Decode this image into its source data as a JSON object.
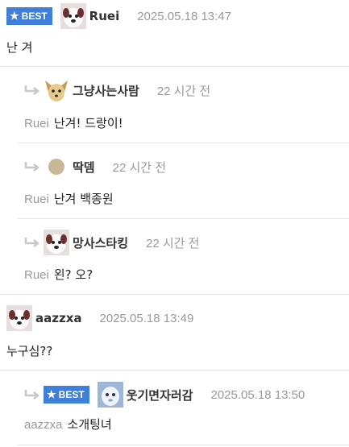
{
  "comments": [
    {
      "author": "Ruei",
      "time": "2025.05.18 13:47",
      "badge": "BEST",
      "text": "난 겨",
      "avatar": "white-dog-avatar"
    },
    {
      "author": "그냥사는사람",
      "time": "22 시간 전",
      "mention": "Ruei",
      "text": "난겨! 드랑이!",
      "avatar": "chihuahua-avatar"
    },
    {
      "author": "딱뎀",
      "time": "22 시간 전",
      "mention": "Ruei",
      "text": "난겨 백종원",
      "avatar": "beige-circle-avatar"
    },
    {
      "author": "망사스타킹",
      "time": "22 시간 전",
      "mention": "Ruei",
      "text": "왼? 오?",
      "avatar": "white-dog-avatar"
    },
    {
      "author": "aazzxa",
      "time": "2025.05.18 13:49",
      "text": "누구심??",
      "avatar": "white-dog-avatar"
    },
    {
      "author": "웃기면자러감",
      "time": "2025.05.18 13:50",
      "badge": "BEST",
      "mention": "aazzxa",
      "text": "소개팅녀",
      "avatar": "blue-creature-avatar"
    }
  ],
  "colors": {
    "badge": "#3f7fd9",
    "muted": "#999999",
    "divider": "#e3e3e3"
  }
}
